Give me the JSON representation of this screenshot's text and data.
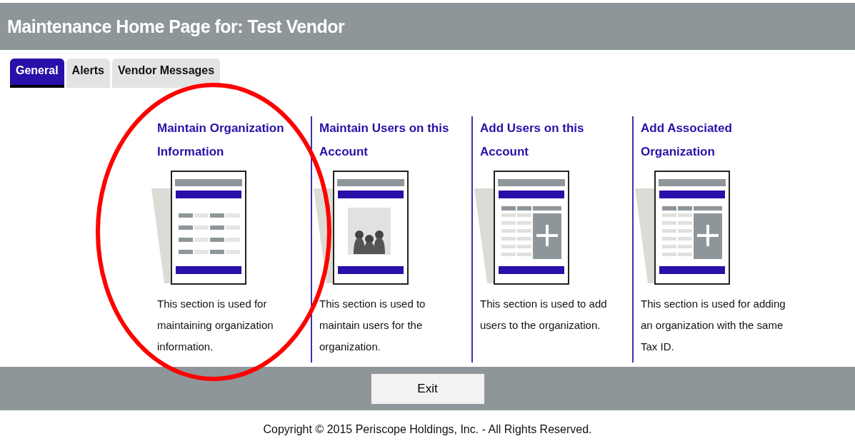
{
  "window": {
    "title": "Maintenance Home Page for: Test Vendor"
  },
  "tabs": [
    {
      "label": "General",
      "selected": true
    },
    {
      "label": "Alerts",
      "selected": false
    },
    {
      "label": "Vendor Messages",
      "selected": false
    }
  ],
  "sections": [
    {
      "title": "Maintain Organization Information",
      "kind": "form",
      "description": "This section is used for maintaining organization information."
    },
    {
      "title": "Maintain Users on this Account",
      "kind": "users",
      "description": "This section is used to maintain users for the organization."
    },
    {
      "title": "Add Users on this Account",
      "kind": "add",
      "description": "This section is used to add users to the organization."
    },
    {
      "title": "Add Associated Organization",
      "kind": "add",
      "description": "This section is used for adding an organization with the same Tax ID."
    }
  ],
  "annotation": {
    "kind": "circle",
    "color": "#ff0000"
  },
  "buttons": [
    "Exit"
  ],
  "footer": "Copyright © 2015 Periscope Holdings, Inc. - All Rights Reserved."
}
